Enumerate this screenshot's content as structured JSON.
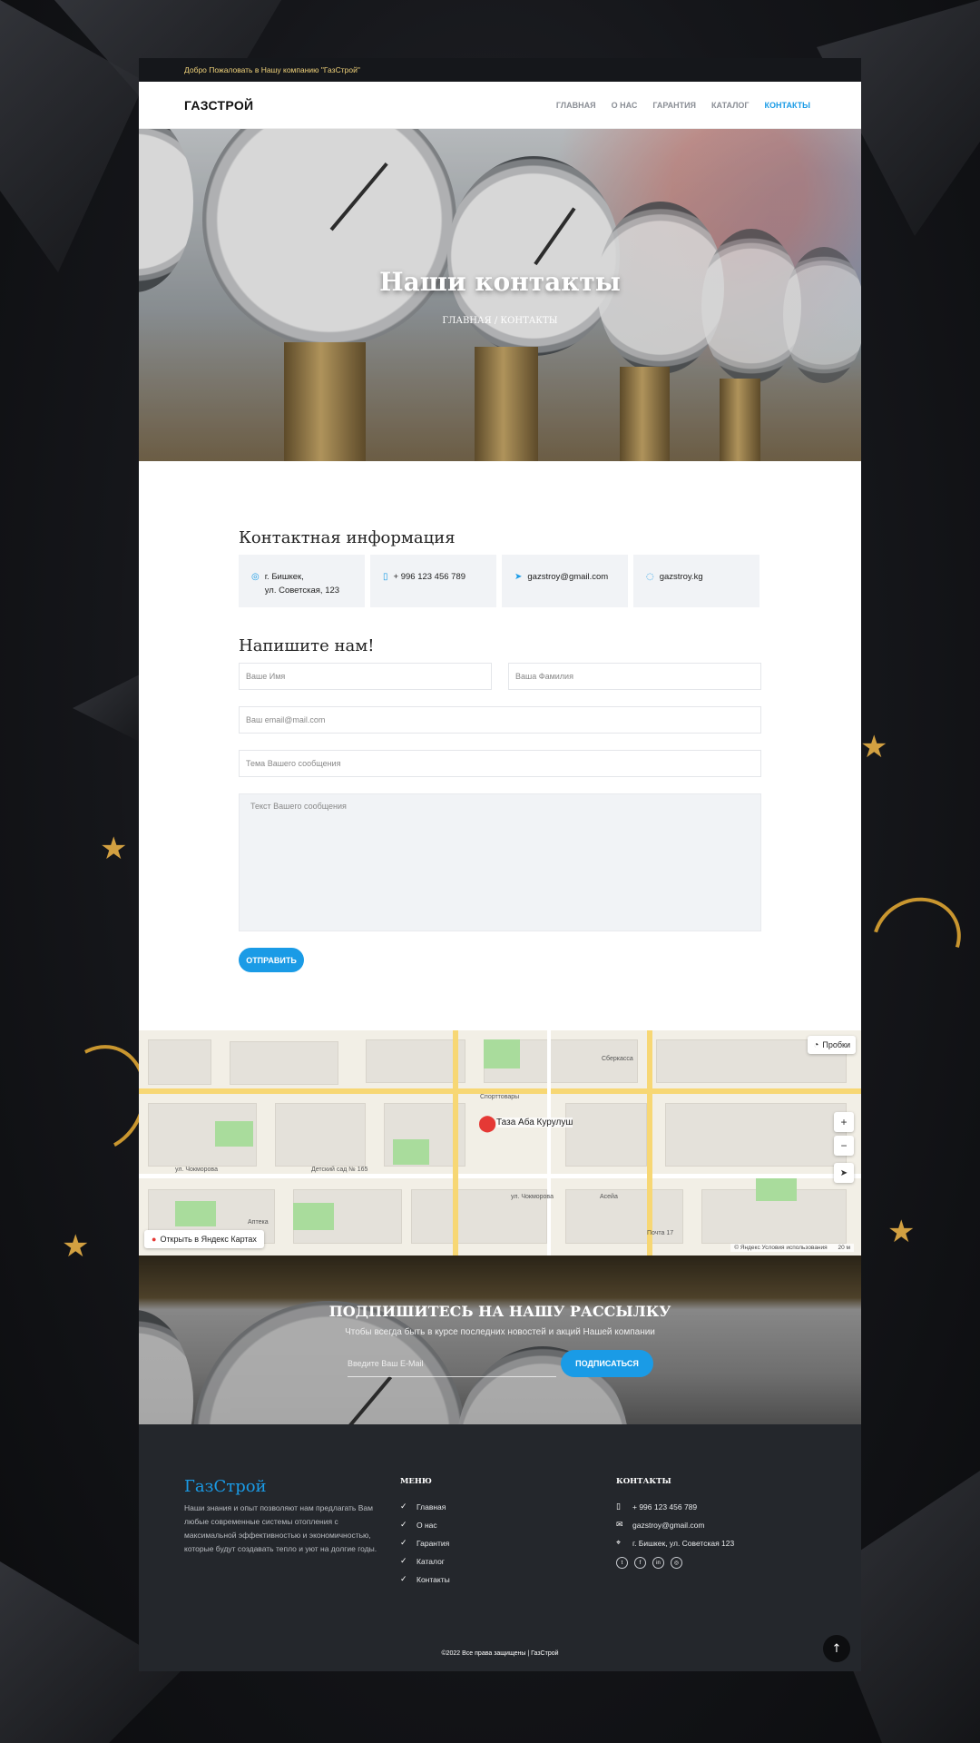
{
  "topbar": {
    "welcome": "Добро Пожаловать в Нашу компанию \"ГазСтрой\""
  },
  "navbar": {
    "logo": "ГАЗСТРОЙ",
    "menu": [
      "ГЛАВНАЯ",
      "О НАС",
      "ГАРАНТИЯ",
      "КАТАЛОГ",
      "КОНТАКТЫ"
    ],
    "active": "КОНТАКТЫ"
  },
  "hero": {
    "title": "Наши контакты",
    "breadcrumb": "ГЛАВНАЯ / КОНТАКТЫ"
  },
  "contact_info": {
    "heading": "Контактная информация",
    "address_line1": "г. Бишкек,",
    "address_line2": "ул. Советская, 123",
    "phone": "+ 996 123 456 789",
    "email": "gazstroy@gmail.com",
    "website": "gazstroy.kg"
  },
  "form": {
    "heading": "Напишите нам!",
    "first_name_placeholder": "Ваше Имя",
    "last_name_placeholder": "Ваша Фамилия",
    "email_placeholder": "Ваш email@mail.com",
    "subject_placeholder": "Тема Вашего сообщения",
    "message_placeholder": "Текст Вашего сообщения",
    "submit_label": "ОТПРАВИТЬ"
  },
  "map": {
    "place": "Таза Аба Курулуш",
    "traffic": "Пробки",
    "open_label": "Открыть в Яндекс Картах",
    "attribution": "© Яндекс   Условия использования",
    "scale": "20 м",
    "labels": [
      "ул. Чокморова",
      "ул. Чокморова",
      "Спорттовары",
      "Сберкасса",
      "Детский сад № 165",
      "Аптека",
      "Почта 17",
      "Асейа"
    ]
  },
  "subscribe": {
    "title": "ПОДПИШИТЕСЬ НА НАШУ РАССЫЛКУ",
    "text": "Чтобы всегда быть в курсе последних новостей и акций Нашей компании",
    "input_placeholder": "Введите Ваш E-Mail",
    "button_label": "ПОДПИСАТЬСЯ"
  },
  "footer": {
    "brand": "ГазСтрой",
    "about": "Наши знания и опыт позволяют нам предлагать Вам любые современные системы отопления с максимальной эффективностью и экономичностью, которые будут создавать тепло и уют на долгие годы.",
    "menu_heading": "МЕНЮ",
    "menu": [
      "Главная",
      "О нас",
      "Гарантия",
      "Каталог",
      "Контакты"
    ],
    "contacts_heading": "КОНТАКТЫ",
    "phone": "+ 996 123 456 789",
    "email": "gazstroy@gmail.com",
    "address": "г. Бишкек, ул. Советская 123",
    "copyright": "©2022 Все права защищены | ГазСтрой"
  },
  "colors": {
    "accent": "#1a9be6",
    "footer_bg": "#24272c",
    "topbar_text": "#f0d27a"
  }
}
